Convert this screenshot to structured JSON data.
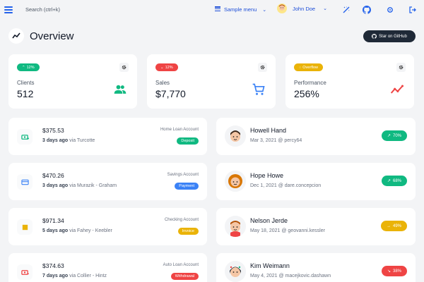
{
  "topbar": {
    "search_placeholder": "Search (ctrl+k)",
    "sample_menu_label": "Sample menu",
    "user_name": "John Doe"
  },
  "header": {
    "title": "Overview",
    "github_button": "Star on GitHub"
  },
  "colors": {
    "accent": "#2563eb",
    "success": "#10b981",
    "danger": "#ef4444",
    "warning": "#eab308",
    "dark": "#1f2937"
  },
  "stats": [
    {
      "badge": "12%",
      "badge_icon": "arrow-up-icon",
      "badge_color": "#10b981",
      "label": "Clients",
      "value": "512",
      "icon": "users-icon",
      "icon_color": "#10b981"
    },
    {
      "badge": "12%",
      "badge_icon": "arrow-down-icon",
      "badge_color": "#ef4444",
      "label": "Sales",
      "value": "$7,770",
      "icon": "cart-icon",
      "icon_color": "#3b82f6"
    },
    {
      "badge": "Overflow",
      "badge_icon": "alert-circle-icon",
      "badge_color": "#eab308",
      "label": "Performance",
      "value": "256%",
      "icon": "trend-line-icon",
      "icon_color": "#ef4444"
    }
  ],
  "transactions": [
    {
      "amount": "$375.53",
      "when": "3 days ago",
      "via_text": "via Turcotte",
      "account": "Home Loan Account",
      "type": "Deposit",
      "type_color": "#10b981",
      "icon": "cash-icon",
      "icon_color": "#10b981"
    },
    {
      "amount": "$470.26",
      "when": "3 days ago",
      "via_text": "via Murazik - Graham",
      "account": "Savings Account",
      "type": "Payment",
      "type_color": "#3b82f6",
      "icon": "credit-card-icon",
      "icon_color": "#3b82f6"
    },
    {
      "amount": "$971.34",
      "when": "5 days ago",
      "via_text": "via Fahey - Keebler",
      "account": "Checking Account",
      "type": "Invoice",
      "type_color": "#eab308",
      "icon": "receipt-icon",
      "icon_color": "#eab308"
    },
    {
      "amount": "$374.63",
      "when": "7 days ago",
      "via_text": "via Collier - Hintz",
      "account": "Auto Loan Account",
      "type": "Withdrawal",
      "type_color": "#ef4444",
      "icon": "cash-minus-icon",
      "icon_color": "#ef4444"
    }
  ],
  "clients": [
    {
      "name": "Howell Hand",
      "meta": "Mar 3, 2021 @ percy64",
      "trend": "70%",
      "trend_icon": "trending-up-icon",
      "trend_color": "#10b981"
    },
    {
      "name": "Hope Howe",
      "meta": "Dec 1, 2021 @ dare.concepcion",
      "trend": "68%",
      "trend_icon": "trending-up-icon",
      "trend_color": "#10b981"
    },
    {
      "name": "Nelson Jerde",
      "meta": "May 18, 2021 @ geovanni.kessler",
      "trend": "49%",
      "trend_icon": "trending-neutral-icon",
      "trend_color": "#eab308"
    },
    {
      "name": "Kim Weimann",
      "meta": "May 4, 2021 @ macejkovic.dashawn",
      "trend": "38%",
      "trend_icon": "trending-down-icon",
      "trend_color": "#ef4444"
    }
  ]
}
